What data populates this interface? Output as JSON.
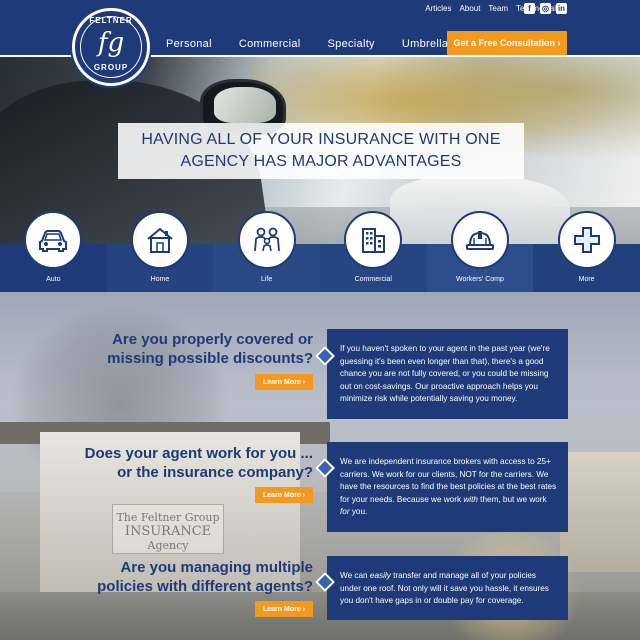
{
  "logo": {
    "top_text": "FELTNER",
    "mark": "fg",
    "bottom_text": "GROUP"
  },
  "utility_links": [
    "Articles",
    "About",
    "Team",
    "Testimonials"
  ],
  "social": [
    {
      "icon": "facebook-icon",
      "glyph": "f"
    },
    {
      "icon": "instagram-icon",
      "glyph": "◎"
    },
    {
      "icon": "linkedin-icon",
      "glyph": "in"
    }
  ],
  "nav": [
    "Personal",
    "Commercial",
    "Specialty",
    "Umbrella"
  ],
  "cta_label": "Get a Free Consultation ›",
  "hero": {
    "line1": "HAVING ALL OF YOUR INSURANCE WITH ONE",
    "line2": "AGENCY HAS MAJOR ADVANTAGES"
  },
  "categories": [
    {
      "label": "Auto",
      "icon": "car-icon"
    },
    {
      "label": "Home",
      "icon": "house-icon"
    },
    {
      "label": "Life",
      "icon": "family-icon"
    },
    {
      "label": "Commercial",
      "icon": "building-icon"
    },
    {
      "label": "Workers' Comp",
      "icon": "hardhat-icon"
    },
    {
      "label": "More",
      "icon": "plus-icon"
    }
  ],
  "building_sign": {
    "line1": "The Feltner Group",
    "line2": "INSURANCE",
    "line3": "Agency"
  },
  "sections": [
    {
      "question_line1": "Are you properly covered or",
      "question_line2": "missing possible discounts?",
      "button": "Learn More ›",
      "body": "If you haven't spoken to your agent in the past year (we're guessing it's been even longer than that), there's a good chance you are not fully covered, or you could be missing out on cost-savings. Our proactive approach helps you minimize risk while potentially saving you money."
    },
    {
      "question_line1": "Does your agent work for you ...",
      "question_line2": "or the insurance company?",
      "button": "Learn More ›",
      "body_pre": "We are independent insurance brokers with access to 25+ carriers. We work for our clients, NOT for the carriers. We have the resources to find the best policies at the best rates for your needs. Because we work ",
      "body_em1": "with",
      "body_mid": " them, but we work ",
      "body_em2": "for",
      "body_post": " you."
    },
    {
      "question_line1": "Are you managing multiple",
      "question_line2": "policies with different agents?",
      "button": "Learn More ›",
      "body_pre": "We can ",
      "body_em1": "easily",
      "body_post": " transfer and manage all of your policies under one roof. Not only will it save you hassle, it ensures you don't have gaps in or double pay for coverage."
    }
  ],
  "colors": {
    "navy": "#1e3a78",
    "orange": "#f39a1e"
  }
}
